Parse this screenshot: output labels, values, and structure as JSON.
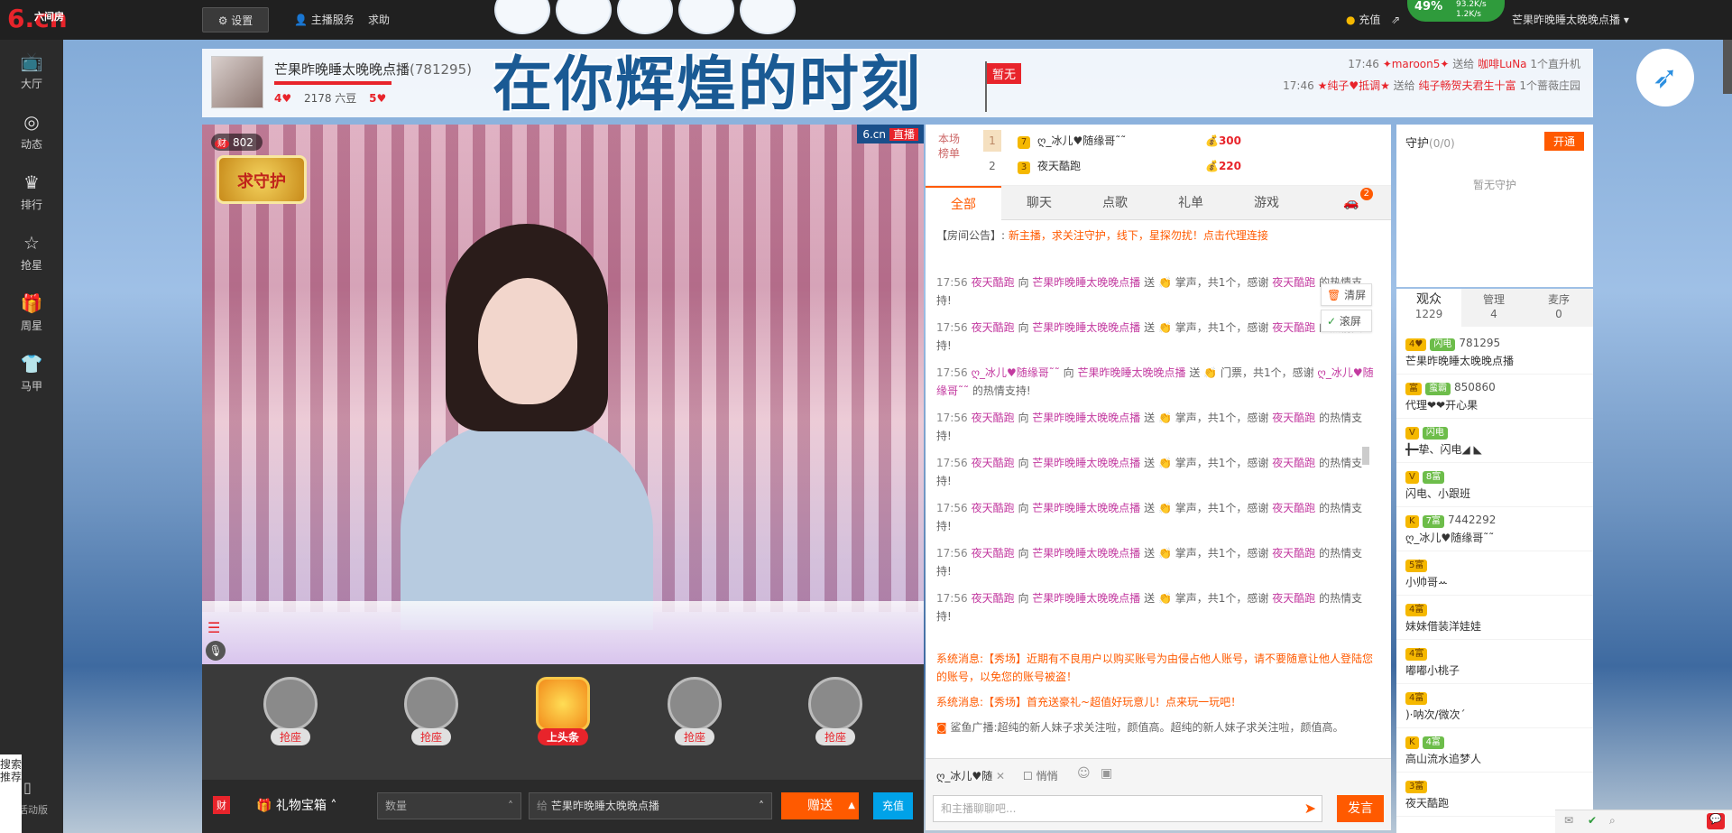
{
  "topbar": {
    "logo_text": "6.cn",
    "logo_sub": "六间房",
    "settings_label": "设置",
    "anchor_service": "主播服务",
    "help": "求助",
    "recharge": "充值",
    "username": "芒果昨晚睡太晚晚点播",
    "speed_pct": "49%",
    "speed_up": "93.2K/s",
    "speed_down": "1.2K/s"
  },
  "sidebar": {
    "items": [
      {
        "label": "大厅",
        "icon": "tv-icon"
      },
      {
        "label": "动态",
        "icon": "compass-icon"
      },
      {
        "label": "排行",
        "icon": "crown-icon"
      },
      {
        "label": "抢星",
        "icon": "star-icon"
      },
      {
        "label": "周星",
        "icon": "gift-icon"
      },
      {
        "label": "马甲",
        "icon": "shirt-icon"
      }
    ],
    "bottom": "活动版",
    "search_pill": "搜索推荐"
  },
  "room": {
    "title": "芒果昨晚睡太晚晚点播",
    "room_id": "(781295)",
    "hearts_left": "4",
    "beans": "2178 六豆",
    "hearts_right": "5",
    "banner": "在你辉煌的时刻",
    "flag": "暂无",
    "feed": [
      {
        "time": "17:46",
        "from": "✦maroon5✦",
        "verb": "送给",
        "to": "咖啡LuNa",
        "item": "1个直升机"
      },
      {
        "time": "17:46",
        "from": "★纯子♥抵调★",
        "verb": "送给",
        "to": "纯子畅贺夫君生十富",
        "item": "1个蔷薇庄园"
      }
    ]
  },
  "video": {
    "cai_count": "802",
    "cai_label": "财",
    "brand": "6.cn",
    "live": "直播",
    "guard_badge": "求守护"
  },
  "seats": [
    {
      "label": "抢座"
    },
    {
      "label": "抢座"
    },
    {
      "label": "上头条"
    },
    {
      "label": "抢座"
    },
    {
      "label": "抢座"
    }
  ],
  "giftbar": {
    "cai": "财",
    "gift_box": "礼物宝箱",
    "quantity_placeholder": "数量",
    "to_prefix": "给",
    "to_user": "芒果昨晚睡太晚晚点播",
    "send": "赠送",
    "recharge": "充值"
  },
  "rank": {
    "label": "本场榜单",
    "rows": [
      {
        "num": "1",
        "name": "ღ_冰儿♥随缘哥˜˜",
        "pts": "300"
      },
      {
        "num": "2",
        "name": "夜天酷跑",
        "pts": "220"
      }
    ]
  },
  "chat_tabs": [
    {
      "label": "全部",
      "active": true
    },
    {
      "label": "聊天"
    },
    {
      "label": "点歌"
    },
    {
      "label": "礼单"
    },
    {
      "label": "游戏"
    }
  ],
  "car_badge": "2",
  "notice": {
    "prefix": "【房间公告】:",
    "text": "新主播，求关注守护，线下，星探勿扰！点击代理连接"
  },
  "tools": {
    "clear": "清屏",
    "scroll": "滚屏"
  },
  "messages": [
    {
      "time": "17:56",
      "from": "夜天酷跑",
      "to": "芒果昨晚睡太晚晚点播",
      "gift": "掌声，共1个，感谢",
      "thanks": "夜天酷跑",
      "end": "的热情支持!"
    },
    {
      "time": "17:56",
      "from": "夜天酷跑",
      "to": "芒果昨晚睡太晚晚点播",
      "gift": "掌声，共1个，感谢",
      "thanks": "夜天酷跑",
      "end": "的热情支持!"
    },
    {
      "time": "17:56",
      "from": "ღ_冰儿♥随缘哥˜˜",
      "to": "芒果昨晚睡太晚晚点播",
      "gift": "门票，共1个，感谢",
      "thanks": "ღ_冰儿♥随缘哥˜˜",
      "end": "的热情支持!"
    },
    {
      "time": "17:56",
      "from": "夜天酷跑",
      "to": "芒果昨晚睡太晚晚点播",
      "gift": "掌声，共1个，感谢",
      "thanks": "夜天酷跑",
      "end": "的热情支持!"
    },
    {
      "time": "17:56",
      "from": "夜天酷跑",
      "to": "芒果昨晚睡太晚晚点播",
      "gift": "掌声，共1个，感谢",
      "thanks": "夜天酷跑",
      "end": "的热情支持!"
    },
    {
      "time": "17:56",
      "from": "夜天酷跑",
      "to": "芒果昨晚睡太晚晚点播",
      "gift": "掌声，共1个，感谢",
      "thanks": "夜天酷跑",
      "end": "的热情支持!"
    },
    {
      "time": "17:56",
      "from": "夜天酷跑",
      "to": "芒果昨晚睡太晚晚点播",
      "gift": "掌声，共1个，感谢",
      "thanks": "夜天酷跑",
      "end": "的热情支持!"
    },
    {
      "time": "17:56",
      "from": "夜天酷跑",
      "to": "芒果昨晚睡太晚晚点播",
      "gift": "掌声，共1个，感谢",
      "thanks": "夜天酷跑",
      "end": "的热情支持!"
    }
  ],
  "msg_words": {
    "to": "向",
    "send": "送"
  },
  "system": [
    {
      "label": "系统消息:",
      "text": "【秀场】近期有不良用户以购买账号为由侵占他人账号，请不要随意让他人登陆您的账号，以免您的账号被盗！"
    },
    {
      "label": "系统消息:",
      "text": "【秀场】首充送豪礼~超值好玩意儿！点来玩一玩吧！"
    }
  ],
  "broadcast": {
    "label": "鲨鱼广播:",
    "text": "超纯的新人妹子求关注啦，颜值高。超纯的新人妹子求关注啦，颜值高。"
  },
  "chat_bottom": {
    "target": "ღ_冰儿♥随",
    "quiet": "悄悄",
    "placeholder": "和主播聊聊吧...",
    "post": "发言"
  },
  "guard": {
    "title": "守护",
    "count": "(0/0)",
    "open": "开通",
    "empty": "暂无守护"
  },
  "audience": {
    "tabs": [
      {
        "label": "观众",
        "count": "1229",
        "active": true
      },
      {
        "label": "管理",
        "count": "4"
      },
      {
        "label": "麦序",
        "count": "0"
      }
    ],
    "items": [
      {
        "badge": "4♥",
        "uid": "781295",
        "name": "芒果昨晚睡太晚晚点播",
        "tag": "闪电"
      },
      {
        "badge": "富",
        "uid": "850860",
        "name": "代理❤❤开心果",
        "tag": "蛮霸"
      },
      {
        "badge": "V",
        "uid": "",
        "name": "╋━挚、闪电◢ ◣",
        "tag": "闪电"
      },
      {
        "badge": "V",
        "uid": "",
        "name": "闪电、小跟班",
        "tag": "8富"
      },
      {
        "badge": "K",
        "uid": "7442292",
        "name": "ღ_冰儿♥随缘哥˜˜",
        "tag": "7富"
      },
      {
        "badge": "5富",
        "uid": "",
        "name": "小帅哥ꕀ",
        "tag": ""
      },
      {
        "badge": "4富",
        "uid": "",
        "name": "妹妹借装洋娃娃",
        "tag": ""
      },
      {
        "badge": "4富",
        "uid": "",
        "name": "嘟嘟小桃子",
        "tag": ""
      },
      {
        "badge": "4富",
        "uid": "",
        "name": ")·呐次/微次ˊ",
        "tag": ""
      },
      {
        "badge": "K",
        "uid": "",
        "name": "高山流水追梦人",
        "tag": "4富"
      },
      {
        "badge": "3富",
        "uid": "",
        "name": "夜天酷跑",
        "tag": ""
      }
    ]
  },
  "colors": {
    "accent": "#ff5a00",
    "brand_red": "#e8242b",
    "blue": "#00a2e8"
  }
}
